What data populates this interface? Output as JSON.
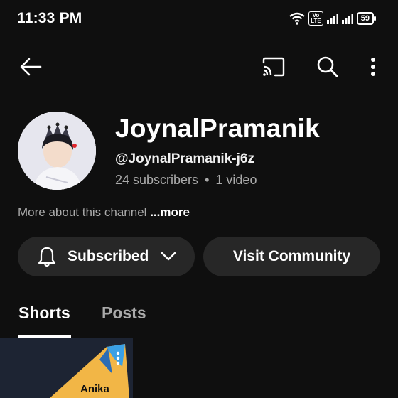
{
  "status_bar": {
    "time": "11:33 PM",
    "volte_top": "Vo",
    "volte_bottom": "LTE",
    "battery": "59"
  },
  "top_bar": {
    "back_icon": "arrow-left-icon",
    "cast_icon": "cast-icon",
    "search_icon": "search-icon",
    "more_icon": "more-vertical-icon"
  },
  "channel": {
    "name": "JoynalPramanik",
    "handle": "@JoynalPramanik-j6z",
    "subscribers": "24 subscribers",
    "separator": "•",
    "videos": "1 video",
    "about_text": "More about this channel",
    "about_more": "...more"
  },
  "actions": {
    "subscribed_label": "Subscribed",
    "visit_community_label": "Visit Community"
  },
  "tabs": [
    {
      "label": "Shorts",
      "active": true
    },
    {
      "label": "Posts",
      "active": false
    }
  ],
  "shorts": [
    {
      "caption": "Anika"
    }
  ],
  "colors": {
    "background": "#0f0f0f",
    "button_bg": "#272727",
    "secondary_text": "#aaaaaa",
    "divider": "#3a3a3a"
  }
}
